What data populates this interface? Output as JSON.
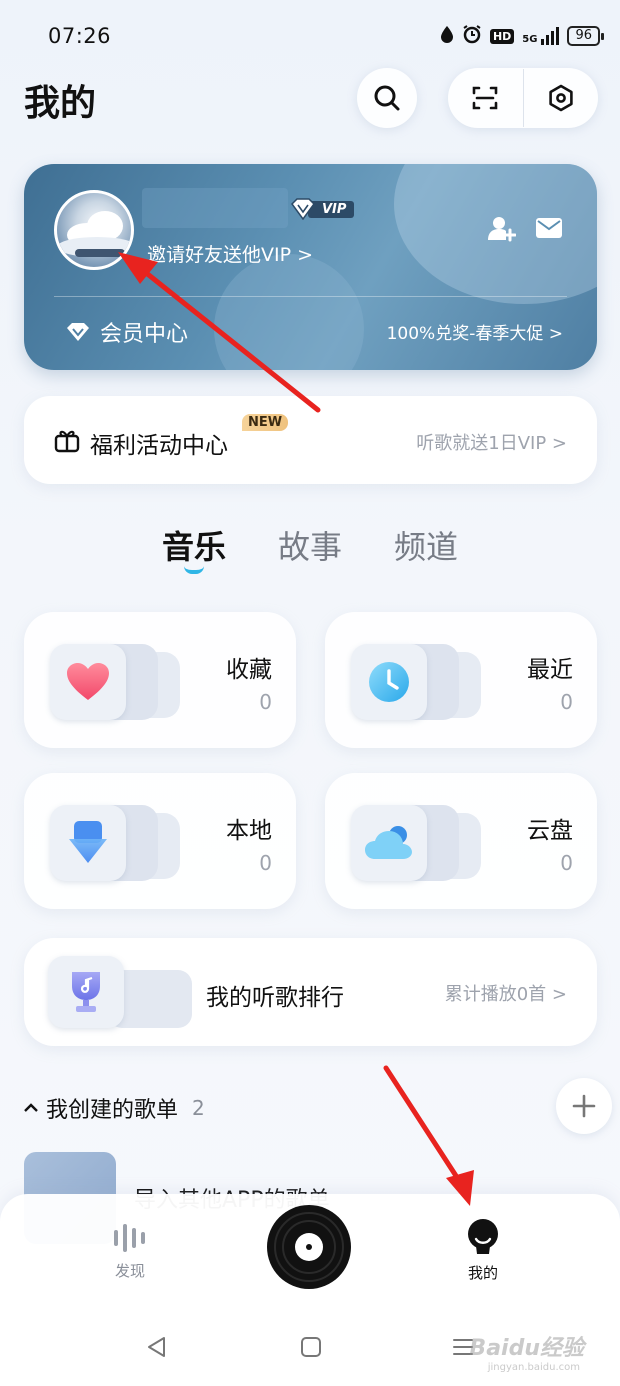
{
  "status_bar": {
    "time": "07:26",
    "network": "5G",
    "hd": "HD",
    "battery": "96"
  },
  "header": {
    "title": "我的"
  },
  "vip_card": {
    "vip_badge": "VIP",
    "invite_text": "邀请好友送他VIP >",
    "member_center": "会员中心",
    "promo": "100%兑奖-春季大促 >"
  },
  "welfare": {
    "title": "福利活动中心",
    "badge": "NEW",
    "subtitle": "听歌就送1日VIP >"
  },
  "tabs": [
    {
      "label": "音乐",
      "active": true
    },
    {
      "label": "故事",
      "active": false
    },
    {
      "label": "频道",
      "active": false
    }
  ],
  "cards": [
    {
      "label": "收藏",
      "count": "0",
      "icon": "heart-icon"
    },
    {
      "label": "最近",
      "count": "0",
      "icon": "clock-icon"
    },
    {
      "label": "本地",
      "count": "0",
      "icon": "download-icon"
    },
    {
      "label": "云盘",
      "count": "0",
      "icon": "cloud-icon"
    }
  ],
  "rank": {
    "title": "我的听歌排行",
    "subtitle": "累计播放0首 >",
    "icon": "trophy-icon"
  },
  "playlists": {
    "header": "我创建的歌单",
    "count": "2",
    "first_title": "导入其他APP的歌单"
  },
  "bottom_nav": {
    "discover": "发现",
    "mine": "我的"
  },
  "watermark": {
    "brand": "Baidu经验",
    "url": "jingyan.baidu.com"
  },
  "colors": {
    "accent": "#2fb6e6",
    "arrow": "#e8231f",
    "vip_card": "#4f7fa3"
  }
}
